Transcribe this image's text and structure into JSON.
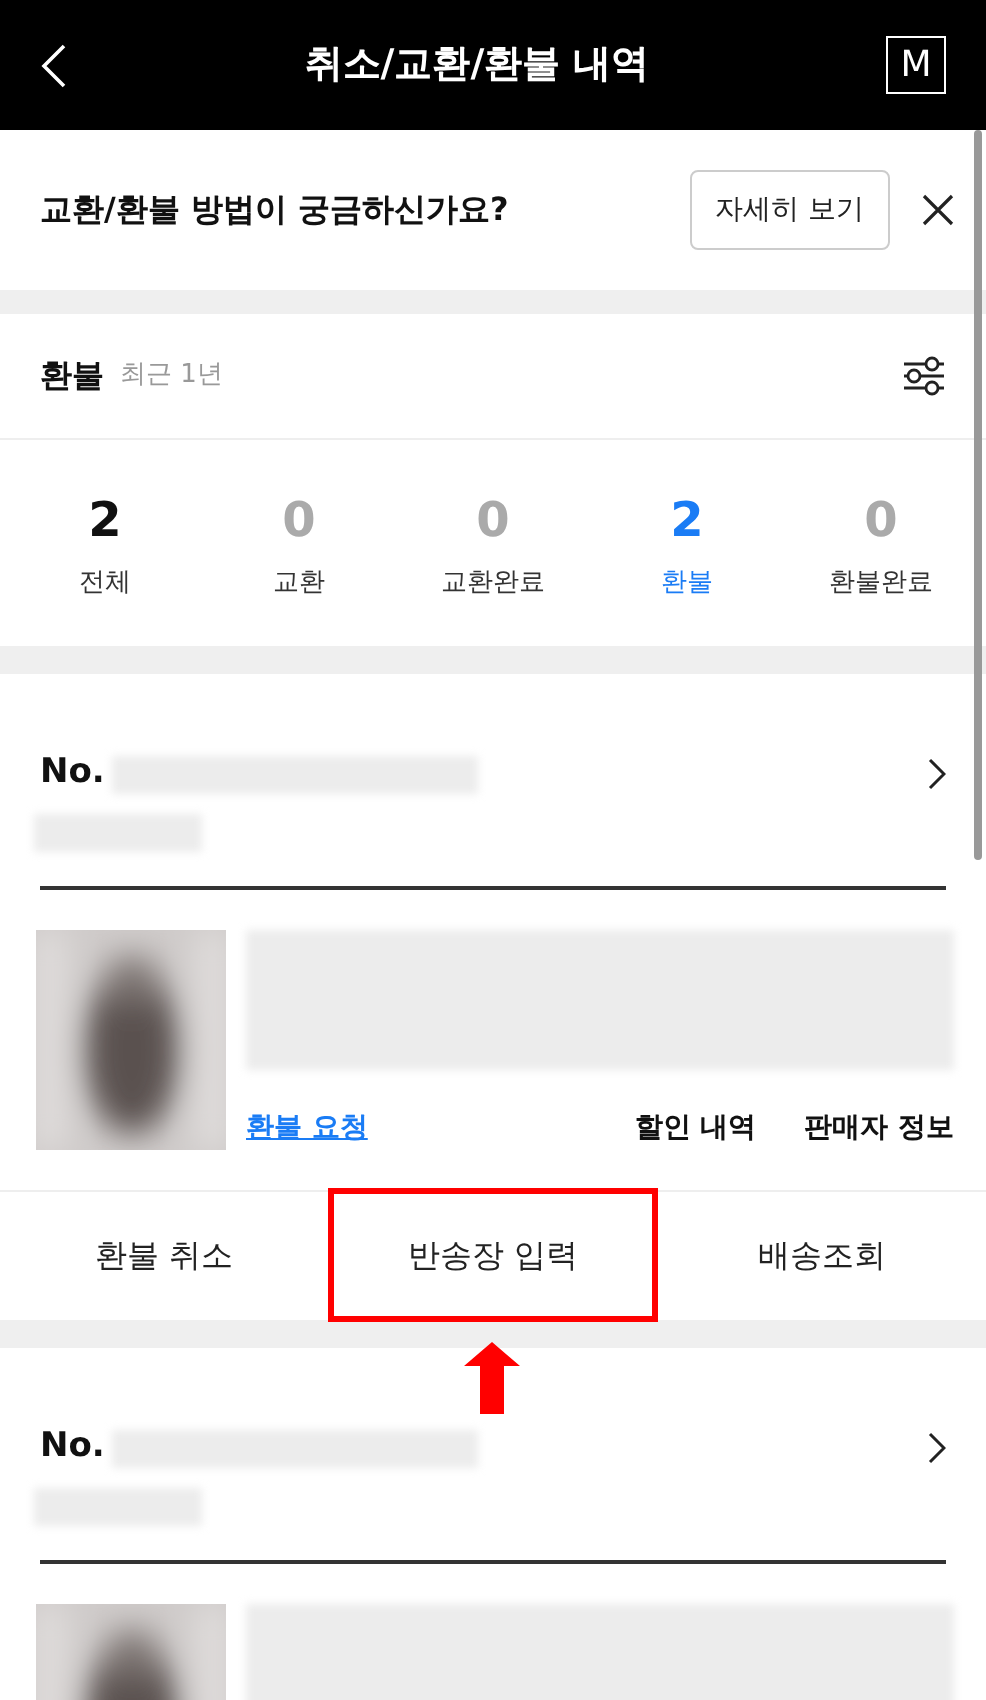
{
  "header": {
    "title": "취소/교환/환불 내역",
    "logo": "M"
  },
  "banner": {
    "text": "교환/환불 방법이 궁금하신가요?",
    "button": "자세히 보기"
  },
  "filter": {
    "title": "환불",
    "period": "최근 1년"
  },
  "stats": [
    {
      "count": "2",
      "label": "전체",
      "selected": false,
      "empty": false
    },
    {
      "count": "0",
      "label": "교환",
      "selected": false,
      "empty": true
    },
    {
      "count": "0",
      "label": "교환완료",
      "selected": false,
      "empty": true
    },
    {
      "count": "2",
      "label": "환불",
      "selected": true,
      "empty": false
    },
    {
      "count": "0",
      "label": "환불완료",
      "selected": false,
      "empty": true
    }
  ],
  "orders": [
    {
      "number_label": "No.",
      "links": [
        {
          "kind": "link",
          "text": "환불 요청"
        },
        {
          "kind": "plain",
          "text": "할인 내역"
        },
        {
          "kind": "plain",
          "text": "판매자 정보"
        }
      ],
      "actions": [
        {
          "label": "환불 취소",
          "highlighted": false
        },
        {
          "label": "반송장 입력",
          "highlighted": true
        },
        {
          "label": "배송조회",
          "highlighted": false
        }
      ]
    },
    {
      "number_label": "No."
    }
  ]
}
